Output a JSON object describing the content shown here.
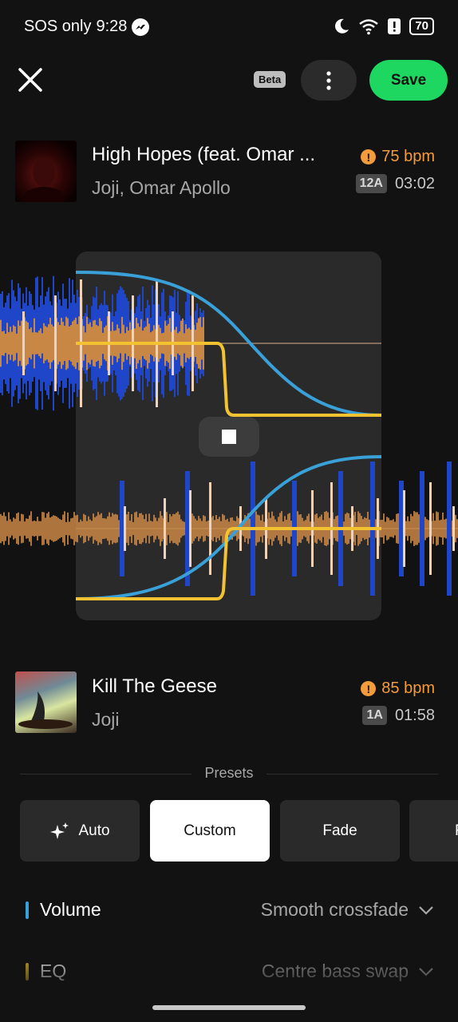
{
  "status_bar": {
    "carrier": "SOS only",
    "time": "9:28",
    "battery": "70"
  },
  "top_bar": {
    "beta_label": "Beta",
    "save_label": "Save"
  },
  "track_a": {
    "title": "High Hopes (feat. Omar ...",
    "artist": "Joji, Omar Apollo",
    "bpm": "75 bpm",
    "key": "12A",
    "duration": "03:02"
  },
  "track_b": {
    "title": "Kill The Geese",
    "artist": "Joji",
    "bpm": "85 bpm",
    "key": "1A",
    "duration": "01:58"
  },
  "presets": {
    "label": "Presets",
    "items": [
      {
        "label": "Auto",
        "icon": "sparkle-icon"
      },
      {
        "label": "Custom",
        "selected": true
      },
      {
        "label": "Fade"
      },
      {
        "label": "F"
      }
    ]
  },
  "settings": [
    {
      "label": "Volume",
      "value": "Smooth crossfade",
      "color": "#3aa0d8"
    },
    {
      "label": "EQ",
      "value": "Centre bass swap",
      "color": "#f2c230"
    }
  ],
  "colors": {
    "accent": "#1ed760",
    "warning": "#f39c3c",
    "curve_blue": "#3aa0d8",
    "curve_yellow": "#f2c230",
    "wave_blue": "#1f45c8",
    "wave_orange": "#c98745"
  }
}
